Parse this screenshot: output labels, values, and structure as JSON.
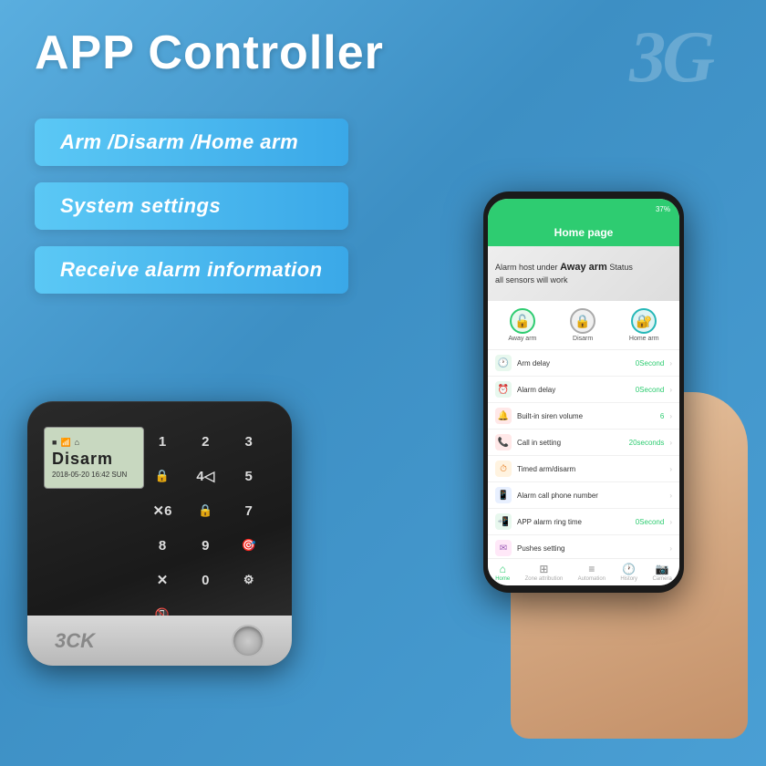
{
  "page": {
    "title": "APP Controller",
    "badge_3g": "3G",
    "bg_color": "#4a9fd4"
  },
  "pills": [
    {
      "id": "pill-arm",
      "label": "Arm /Disarm /Home arm"
    },
    {
      "id": "pill-settings",
      "label": "System settings"
    },
    {
      "id": "pill-alarm",
      "label": "Receive alarm information"
    }
  ],
  "device": {
    "screen": {
      "icons": "■ 📶 ⌂",
      "status": "Disarm",
      "date": "2018-05-20  16:42  SUN"
    },
    "keys": [
      "1",
      "2",
      "3",
      "🔒",
      "4◁",
      "5",
      "✕6",
      "🔒",
      "7",
      "8",
      "9",
      "🎯",
      "✕",
      "0",
      "⚙",
      "📵"
    ]
  },
  "phone": {
    "status_battery": "37%",
    "header_title": "Home page",
    "banner_text": "Alarm host under",
    "banner_bold": "Away arm",
    "banner_sub": "Status",
    "banner_desc": "all sensors will work",
    "arm_buttons": [
      {
        "label": "Away arm",
        "icon": "🔓",
        "color": "green"
      },
      {
        "label": "Disarm",
        "icon": "🔒",
        "color": "gray"
      },
      {
        "label": "Home arm",
        "icon": "🔐",
        "color": "teal"
      }
    ],
    "settings": [
      {
        "label": "Arm delay",
        "value": "0Second",
        "chevron": "›",
        "icon": "🕐",
        "icon_bg": "#e8f8ee",
        "icon_color": "#2ecc71"
      },
      {
        "label": "Alarm delay",
        "value": "0Second",
        "chevron": "›",
        "icon": "⏰",
        "icon_bg": "#e8f8ee",
        "icon_color": "#2ecc71"
      },
      {
        "label": "Built-in siren volume",
        "value": "6",
        "chevron": "›",
        "icon": "🔔",
        "icon_bg": "#ffe8e8",
        "icon_color": "#e74c3c"
      },
      {
        "label": "Call in setting",
        "value": "20seconds",
        "chevron": "›",
        "icon": "📞",
        "icon_bg": "#ffe8e8",
        "icon_color": "#e74c3c"
      },
      {
        "label": "Timed arm/disarm",
        "value": "",
        "chevron": "›",
        "icon": "⏱",
        "icon_bg": "#fff3e0",
        "icon_color": "#e67e22"
      },
      {
        "label": "Alarm call phone number",
        "value": "",
        "chevron": "›",
        "icon": "📱",
        "icon_bg": "#e8f0ff",
        "icon_color": "#3498db"
      },
      {
        "label": "APP alarm ring time",
        "value": "0Second",
        "chevron": "›",
        "icon": "📲",
        "icon_bg": "#e8f8ee",
        "icon_color": "#2ecc71"
      },
      {
        "label": "Pushes setting",
        "value": "",
        "chevron": "›",
        "icon": "✉",
        "icon_bg": "#ffe8f8",
        "icon_color": "#9b59b6"
      }
    ],
    "nav": [
      {
        "label": "Home",
        "icon": "⌂",
        "active": true
      },
      {
        "label": "Zone attribution",
        "icon": "⊞",
        "active": false
      },
      {
        "label": "Automation",
        "icon": "≡",
        "active": false
      },
      {
        "label": "History",
        "icon": "🕐",
        "active": false
      },
      {
        "label": "Camera",
        "icon": "📷",
        "active": false
      }
    ]
  }
}
